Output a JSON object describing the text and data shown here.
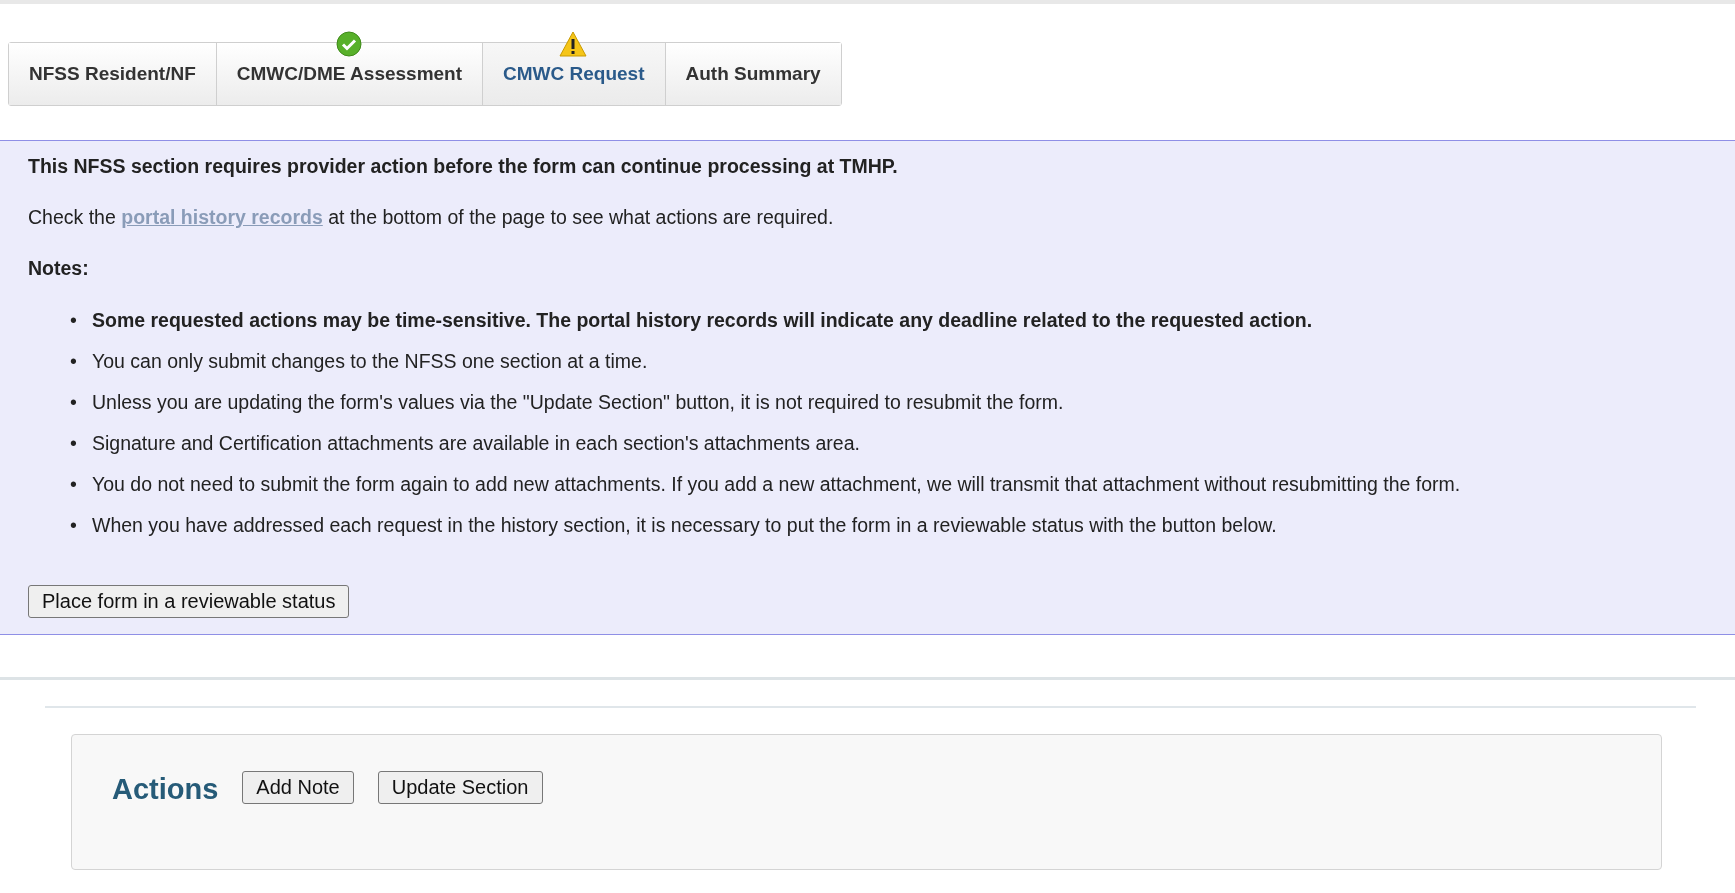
{
  "tabs": [
    {
      "label": "NFSS Resident/NF",
      "selected": false,
      "complete": false,
      "warning": false
    },
    {
      "label": "CMWC/DME Assessment",
      "selected": false,
      "complete": true,
      "warning": false
    },
    {
      "label": "CMWC Request",
      "selected": true,
      "complete": false,
      "warning": true
    },
    {
      "label": "Auth Summary",
      "selected": false,
      "complete": false,
      "warning": false
    }
  ],
  "bullet": "•",
  "notice": {
    "heading": "This NFSS section requires provider action before the form can continue processing at TMHP.",
    "check_before": "Check the",
    "check_link": "portal history records",
    "check_after": "at the bottom of the page to see what actions are required.",
    "notes_label": "Notes:",
    "notes": [
      {
        "text": "Some requested actions may be time-sensitive. The portal history records will indicate any deadline related to the requested action.",
        "bold": true
      },
      {
        "text": "You can only submit changes to the NFSS one section at a time.",
        "bold": false
      },
      {
        "text": "Unless you are updating the form's values via the \"Update Section\" button, it is not required to resubmit the form.",
        "bold": false
      },
      {
        "text": "Signature and Certification attachments are available in each section's attachments area.",
        "bold": false
      },
      {
        "text": "You do not need to submit the form again to add new attachments. If you add a new attachment, we will transmit that attachment without resubmitting the form.",
        "bold": false
      },
      {
        "text": "When you have addressed each request in the history section, it is necessary to put the form in a reviewable status with the button below.",
        "bold": false
      }
    ],
    "button": "Place form in a reviewable status"
  },
  "actions": {
    "title": "Actions",
    "buttons": [
      "Add Note",
      "Update Section"
    ]
  }
}
